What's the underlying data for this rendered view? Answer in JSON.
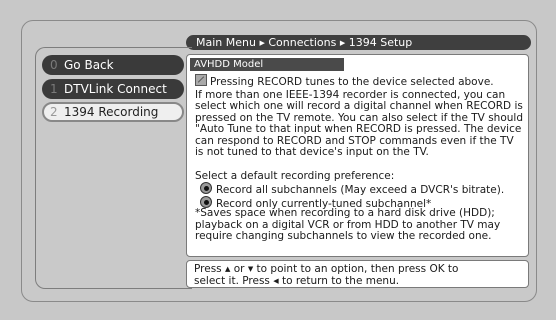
{
  "breadcrumb": {
    "main_menu": "Main Menu",
    "connections": "Connections",
    "current": "1394 Setup",
    "separator": "▶"
  },
  "sidebar": {
    "items": [
      {
        "num": "0",
        "label": "Go Back",
        "state": "normal"
      },
      {
        "num": "1",
        "label": "DTVLink Connect",
        "state": "normal"
      },
      {
        "num": "2",
        "label": "1394 Recording",
        "state": "selected"
      }
    ]
  },
  "panel": {
    "model_label": "AVHDD Model",
    "checkbox_label": "Pressing RECORD tunes to the device selected above.",
    "description": "If more than one IEEE-1394 recorder is connected, you can select which one will record a digital channel when RECORD is pressed on the TV remote. You can also select if the TV should \"Auto Tune to that input when RECORD is pressed. The device can respond to RECORD and STOP commands even if the TV is not tuned to that device's input on the TV.",
    "pref_label": "Select a default recording preference:",
    "options": [
      {
        "label": "Record all subchannels (May exceed a DVCR's bitrate)."
      },
      {
        "label": "Record only currently-tuned subchannel*"
      }
    ],
    "footnote": "*Saves space when recording to a hard disk drive (HDD); playback on a digital VCR or from HDD to another TV may require changing subchannels to view the recorded one."
  },
  "help": {
    "line1_a": "Press",
    "up": "▲",
    "or": "or",
    "down": "▼",
    "line1_b": "to point to an option, then press OK to",
    "line2_a": "select it. Press",
    "left": "◀",
    "line2_b": "to return to the menu."
  },
  "colors": {
    "background": "#c8c8c8",
    "bar_dark": "#3f3f3f",
    "panel": "#ffffff"
  }
}
